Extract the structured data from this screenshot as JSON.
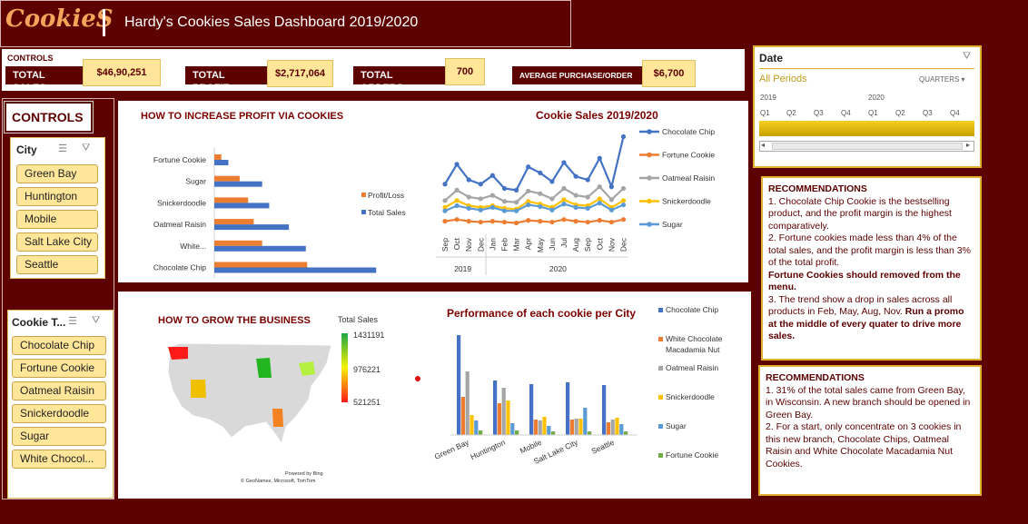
{
  "header": {
    "logo": "CookieS",
    "title": "Hardy's  Cookies Sales Dashboard  2019/2020"
  },
  "kpis": {
    "section_label": "CONTROLS",
    "items": [
      {
        "label": "TOTAL SALES",
        "value": "$46,90,251"
      },
      {
        "label": "TOTAL PROFIT",
        "value": "$2,717,064"
      },
      {
        "label": "TOTAL ORDERS",
        "value": "700"
      },
      {
        "label": "AVERAGE PURCHASE/ORDER",
        "value": "$6,700"
      }
    ]
  },
  "date_slicer": {
    "title": "Date",
    "selection": "All Periods",
    "level": "QUARTERS",
    "years": [
      "2019",
      "2020"
    ],
    "quarters": [
      "Q1",
      "Q2",
      "Q3",
      "Q4",
      "Q1",
      "Q2",
      "Q3",
      "Q4"
    ]
  },
  "controls": {
    "title": "CONTROLS",
    "city_slicer": {
      "title": "City",
      "items": [
        "Green Bay",
        "Huntington",
        "Mobile",
        "Salt Lake City",
        "Seattle"
      ]
    },
    "cookie_slicer": {
      "title": "Cookie T...",
      "items": [
        "Chocolate Chip",
        "Fortune Cookie",
        "Oatmeal Raisin",
        "Snickerdoodle",
        "Sugar",
        "White Chocol..."
      ]
    }
  },
  "profit_panel": {
    "title": "HOW TO INCREASE PROFIT VIA COOKIES"
  },
  "grow_panel": {
    "title": "HOW TO GROW THE BUSINESS",
    "attribution": [
      "Powered by Bing",
      "© GeoNames, Microsoft, TomTom"
    ]
  },
  "colors": {
    "brand": "#5c0000",
    "accent": "#ffe699",
    "gold": "#e0b030",
    "blue": "#4472c4",
    "orange": "#ed7d31",
    "gray": "#a5a5a5",
    "yellow": "#ffc000",
    "lightblue": "#5b9bd5",
    "green": "#70ad47"
  },
  "recommendations": [
    {
      "title": "RECOMMENDATIONS",
      "p1": "1. Chocolate Chip Cookie is the bestselling product, and the profit margin is the highest comparatively.",
      "p2": "2. Fortune cookies made less than 4% of the total sales, and the profit margin is less than 3% of the total profit.",
      "p2_bold": "Fortune Cookies should removed from the menu.",
      "p3": "3. The trend show a drop in sales across all products in Feb, May, Aug, Nov.",
      "p3_bold": "Run a promo at the middle of every quater to drive more sales."
    },
    {
      "title": "RECOMMENDATIONS",
      "p1": "1. 31% of the total sales came from Green Bay, in Wisconsin. A new branch should be opened in Green Bay.",
      "p2": "2. For a start, only concentrate on 3 cookies in this new branch, Chocolate Chips, Oatmeal Raisin and White Chocolate Macadamia Nut Cookies."
    }
  ],
  "chart_data": [
    {
      "type": "bar",
      "orientation": "horizontal",
      "categories": [
        "Fortune Cookie",
        "Sugar",
        "Snickerdoodle",
        "Oatmeal Raisin",
        "White...",
        "Chocolate Chip"
      ],
      "series": [
        {
          "name": "Profit/Loss",
          "values": [
            0.05,
            0.18,
            0.24,
            0.28,
            0.34,
            0.66
          ]
        },
        {
          "name": "Total Sales",
          "values": [
            0.1,
            0.34,
            0.39,
            0.53,
            0.65,
            1.15
          ]
        }
      ],
      "legend": "right"
    },
    {
      "type": "line",
      "title": "Cookie Sales  2019/2020",
      "x": [
        "Sep",
        "Oct",
        "Nov",
        "Dec",
        "Jan",
        "Feb",
        "Mar",
        "Apr",
        "May",
        "Jun",
        "Jul",
        "Aug",
        "Sep",
        "Oct",
        "Nov",
        "Dec"
      ],
      "x_groups": [
        {
          "label": "2019",
          "span": 4
        },
        {
          "label": "2020",
          "span": 12
        }
      ],
      "series": [
        {
          "name": "Chocolate Chip",
          "values": [
            55,
            78,
            60,
            55,
            65,
            50,
            48,
            75,
            68,
            58,
            80,
            64,
            60,
            85,
            52,
            110
          ]
        },
        {
          "name": "Fortune Cookie",
          "values": [
            12,
            14,
            12,
            11,
            12,
            11,
            10,
            13,
            12,
            11,
            14,
            12,
            11,
            13,
            11,
            14
          ]
        },
        {
          "name": "Oatmeal Raisin",
          "values": [
            36,
            48,
            40,
            38,
            42,
            35,
            34,
            47,
            44,
            38,
            50,
            42,
            40,
            52,
            37,
            50
          ]
        },
        {
          "name": "Snickerdoodle",
          "values": [
            28,
            36,
            30,
            28,
            30,
            27,
            26,
            35,
            32,
            28,
            37,
            31,
            30,
            38,
            28,
            36
          ]
        },
        {
          "name": "Sugar",
          "values": [
            24,
            30,
            27,
            25,
            28,
            24,
            24,
            31,
            29,
            25,
            32,
            28,
            27,
            33,
            25,
            31
          ]
        }
      ],
      "legend": "right"
    },
    {
      "type": "bar",
      "title": "Performance of each cookie per City",
      "categories": [
        "Green Bay",
        "Huntington",
        "Mobile",
        "Salt Lake City",
        "Seattle"
      ],
      "series": [
        {
          "name": "Chocolate Chip",
          "values": [
            110,
            60,
            56,
            58,
            55
          ]
        },
        {
          "name": "White Chocolate Macadamia Nut",
          "values": [
            42,
            35,
            17,
            17,
            14
          ]
        },
        {
          "name": "Oatmeal Raisin",
          "values": [
            70,
            52,
            16,
            18,
            17
          ]
        },
        {
          "name": "Snickerdoodle",
          "values": [
            22,
            38,
            20,
            18,
            19
          ]
        },
        {
          "name": "Sugar",
          "values": [
            16,
            13,
            10,
            30,
            12
          ]
        },
        {
          "name": "Fortune Cookie",
          "values": [
            5,
            5,
            4,
            4,
            4
          ]
        }
      ],
      "legend": "right"
    },
    {
      "type": "heatmap",
      "subtype": "map",
      "legend_title": "Total Sales",
      "legend_values": [
        "1431191",
        "976221",
        "521251"
      ],
      "regions": [
        "Washington",
        "Wisconsin",
        "Utah",
        "Alabama",
        "West Virginia"
      ]
    }
  ]
}
